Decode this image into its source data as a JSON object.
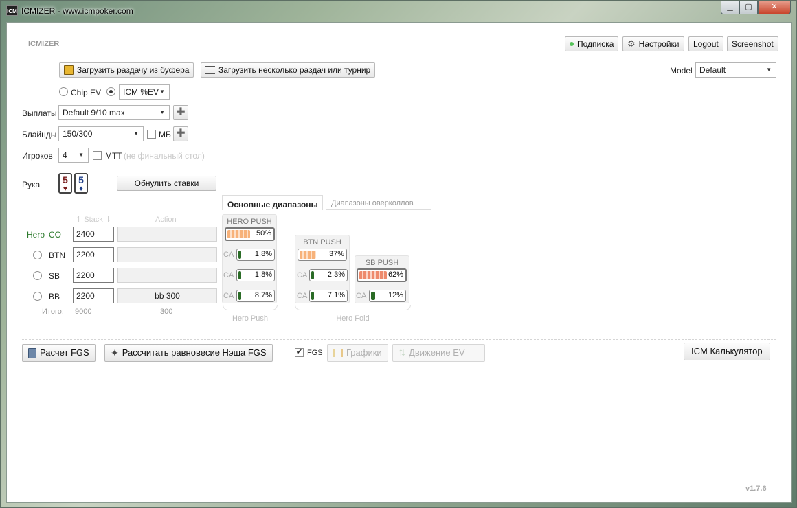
{
  "window": {
    "title": "ICMIZER - www.icmpoker.com",
    "logo": "ICM",
    "min": "▁",
    "max": "▢",
    "close": "✕"
  },
  "header": {
    "brand": "ICMIZER",
    "subscribe": "Подписка",
    "subscribe_dot_color": "#56c35a",
    "settings": "Настройки",
    "logout": "Logout",
    "screenshot": "Screenshot"
  },
  "load": {
    "from_buffer": "Загрузить раздачу из буфера",
    "multiple": "Загрузить несколько раздач или турнир"
  },
  "model": {
    "label": "Model",
    "value": "Default"
  },
  "ev": {
    "chip": "Chip EV",
    "icm": "ICM %EV"
  },
  "payouts": {
    "label": "Выплаты",
    "value": "Default 9/10 max"
  },
  "blinds": {
    "label": "Блайнды",
    "value": "150/300",
    "mb": "МБ"
  },
  "players": {
    "label": "Игроков",
    "value": "4",
    "mtt": "MTT",
    "mtt_hint": "(не финальный стол)"
  },
  "hand": {
    "label": "Рука",
    "card1": "5",
    "card1_suit": "♥",
    "card2": "5",
    "card2_suit": "♦",
    "reset": "Обнулить ставки"
  },
  "tabs": {
    "main": "Основные диапазоны",
    "overcall": "Диапазоны оверколлов"
  },
  "table": {
    "stack_header": "Stack",
    "action_header": "Action",
    "hero_label": "Hero",
    "rows": [
      {
        "pos": "CO",
        "stack": "2400",
        "action": ""
      },
      {
        "pos": "BTN",
        "stack": "2200",
        "action": ""
      },
      {
        "pos": "SB",
        "stack": "2200",
        "action": ""
      },
      {
        "pos": "BB",
        "stack": "2200",
        "action": "bb 300"
      }
    ],
    "total_label": "Итого:",
    "total_stack": "9000",
    "total_action": "300"
  },
  "ranges": {
    "ca": "CA",
    "hero_push": {
      "title": "HERO PUSH",
      "push": "50%",
      "push_val": 50,
      "btn": "1.8%",
      "btn_val": 1.8,
      "sb": "1.8%",
      "sb_val": 1.8,
      "bb": "8.7%",
      "bb_val": 8.7
    },
    "btn_push": {
      "title": "BTN PUSH",
      "push": "37%",
      "push_val": 37,
      "sb": "2.3%",
      "sb_val": 2.3,
      "bb": "7.1%",
      "bb_val": 7.1
    },
    "sb_push": {
      "title": "SB PUSH",
      "push": "62%",
      "push_val": 62,
      "bb": "12%",
      "bb_val": 12
    },
    "bracket_hero": "Hero Push",
    "bracket_fold": "Hero Fold"
  },
  "bottom": {
    "calc_fgs": "Расчет FGS",
    "nash": "Рассчитать равновесие Нэша FGS",
    "fgs": "FGS",
    "graphs": "Графики",
    "ev_move": "Движение EV",
    "icm_calc": "ICM Калькулятор"
  },
  "version": "v1.7.6"
}
